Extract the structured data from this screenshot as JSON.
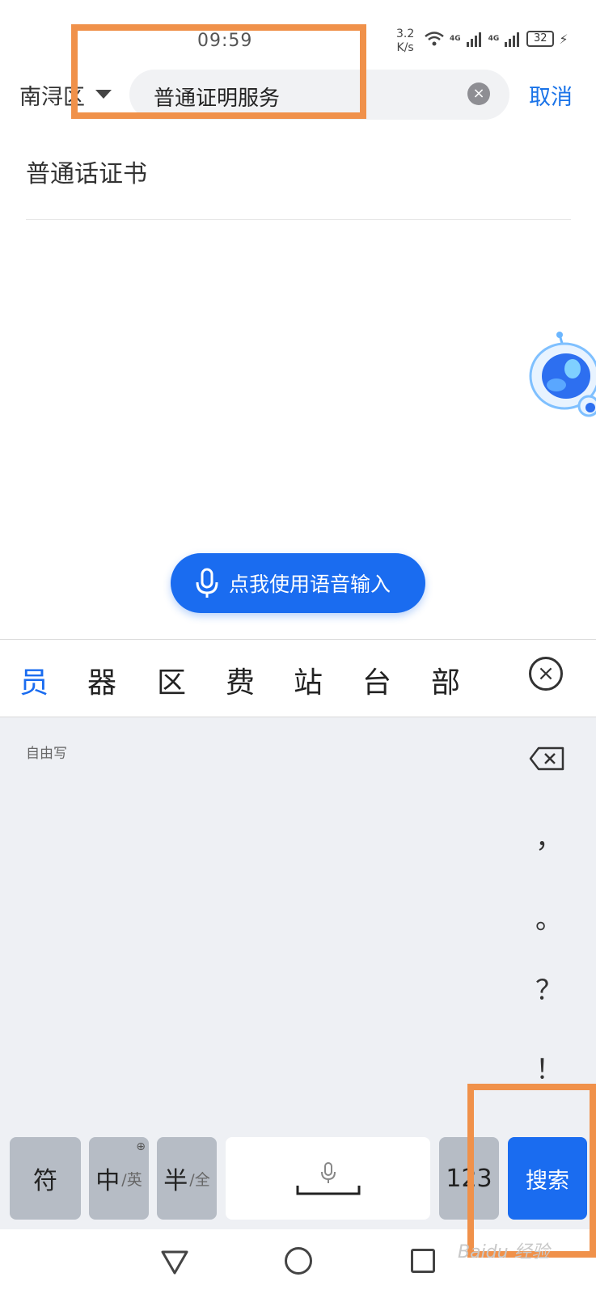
{
  "status_bar": {
    "time": "09:59",
    "net_speed_value": "3.2",
    "net_speed_unit": "K/s",
    "signal_1": "4G",
    "signal_2": "4G",
    "battery": "32"
  },
  "search_bar": {
    "region": "南浔区",
    "query": "普通证明服务",
    "cancel_label": "取消"
  },
  "suggestions": [
    "普通话证书"
  ],
  "voice_button": {
    "label": "点我使用语音输入"
  },
  "candidates": [
    "员",
    "器",
    "区",
    "费",
    "站",
    "台",
    "部"
  ],
  "keyboard": {
    "handwriting_label": "自由写",
    "punctuation": [
      "，",
      "。",
      "？",
      "！"
    ],
    "keys": {
      "symbol": "符",
      "chinese": "中",
      "english": "/英",
      "half": "半",
      "full": "/全",
      "numbers": "123",
      "search": "搜索"
    }
  },
  "watermark": "Baidu 经验",
  "colors": {
    "accent": "#1a6cf0",
    "annotation": "#f0914a"
  }
}
